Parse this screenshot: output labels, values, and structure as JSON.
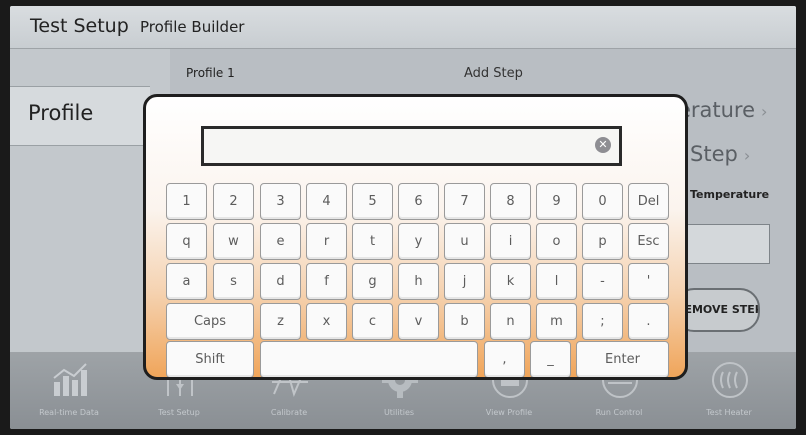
{
  "header": {
    "title": "Test Setup",
    "subtitle": "Profile Builder"
  },
  "sidebar": {
    "tab_label": "Profile"
  },
  "main": {
    "profile_name": "Profile 1",
    "add_step_label": "Add Step",
    "right_items": [
      "Temperature",
      "Step"
    ],
    "temperature_label": "Temperature",
    "remove_step_label": "REMOVE STEP"
  },
  "bottom_nav": [
    {
      "label": "Real-time Data",
      "icon": "chart-icon"
    },
    {
      "label": "Test Setup",
      "icon": "sliders-icon"
    },
    {
      "label": "Calibrate",
      "icon": "calibrate-icon"
    },
    {
      "label": "Utilities",
      "icon": "gear-icon"
    },
    {
      "label": "View Profile",
      "icon": "profile-icon"
    },
    {
      "label": "Run Control",
      "icon": "run-icon"
    },
    {
      "label": "Test Heater",
      "icon": "heat-icon"
    }
  ],
  "keyboard": {
    "input_value": "",
    "rows": [
      [
        "1",
        "2",
        "3",
        "4",
        "5",
        "6",
        "7",
        "8",
        "9",
        "0",
        "Del"
      ],
      [
        "q",
        "w",
        "e",
        "r",
        "t",
        "y",
        "u",
        "i",
        "o",
        "p",
        "Esc"
      ],
      [
        "a",
        "s",
        "d",
        "f",
        "g",
        "h",
        "j",
        "k",
        "l",
        "-",
        "'"
      ],
      [
        "Caps",
        "z",
        "x",
        "c",
        "v",
        "b",
        "n",
        "m",
        ";",
        "."
      ],
      [
        "Shift",
        " ",
        ",",
        "_",
        "Enter"
      ]
    ]
  }
}
